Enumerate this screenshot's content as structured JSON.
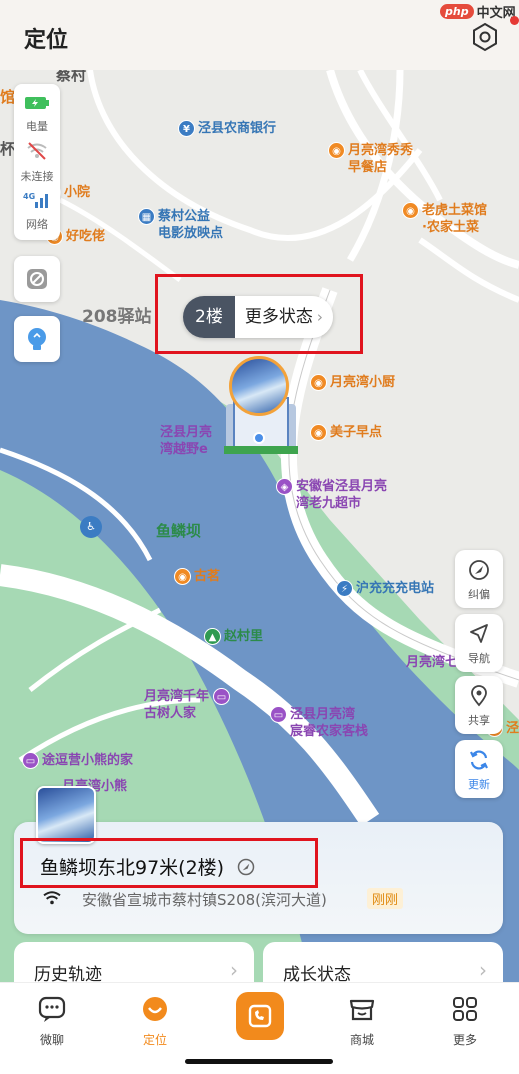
{
  "header": {
    "title": "定位",
    "watermark_brand": "php",
    "watermark_text": "中文网"
  },
  "status_panel": {
    "battery_label": "电量",
    "wifi_label": "未连接",
    "network_label": "网络",
    "network_badge": "4G"
  },
  "map": {
    "pois": [
      {
        "text": "泾县农商银行",
        "color": "blue"
      },
      {
        "text": "月亮湾秀秀\n早餐店",
        "color": "orange"
      },
      {
        "text": "老虎土菜馆\n·农家土菜",
        "color": "orange"
      },
      {
        "text": "蔡村公益\n电影放映点",
        "color": "blue"
      },
      {
        "text": "好吃佬",
        "color": "orange"
      },
      {
        "text": "小院",
        "color": "orange"
      },
      {
        "text": "月亮湾小厨",
        "color": "orange"
      },
      {
        "text": "美子早点",
        "color": "orange"
      },
      {
        "text": "泾县月亮\n湾越野e",
        "color": "purple"
      },
      {
        "text": "安徽省泾县月亮\n湾老九超市",
        "color": "purple"
      },
      {
        "text": "古茗",
        "color": "orange"
      },
      {
        "text": "沪充充充电站",
        "color": "blue"
      },
      {
        "text": "赵村里",
        "color": "green"
      },
      {
        "text": "月亮湾千年\n古树人家",
        "color": "purple"
      },
      {
        "text": "泾县月亮湾\n宸睿农家客栈",
        "color": "purple"
      },
      {
        "text": "途逗营小熊的家",
        "color": "purple"
      },
      {
        "text": "月亮湾小熊\n民宿",
        "color": "purple"
      },
      {
        "text": "月亮湾七采民宿",
        "color": "purple"
      },
      {
        "text": "泾河",
        "color": "orange"
      }
    ],
    "labels": {
      "village": "蔡村",
      "station": "208驿站",
      "dam": "鱼鳞坝",
      "edge_left1": "馆",
      "edge_left2": "杯"
    }
  },
  "floor_bubble": {
    "floor": "2楼",
    "more": "更多状态"
  },
  "tools": [
    {
      "label": "纠偏",
      "icon": "calibrate-icon"
    },
    {
      "label": "导航",
      "icon": "navigate-icon"
    },
    {
      "label": "共享",
      "icon": "share-location-icon"
    },
    {
      "label": "更新",
      "icon": "refresh-icon"
    }
  ],
  "location_card": {
    "place": "鱼鳞坝东北97米(2楼)",
    "address": "安徽省宣城市蔡村镇S208(滨河大道)",
    "time_badge": "刚刚"
  },
  "entries": {
    "history": "历史轨迹",
    "growth": "成长状态"
  },
  "tabs": [
    {
      "label": "微聊"
    },
    {
      "label": "定位"
    },
    {
      "label": "商城"
    },
    {
      "label": "更多"
    }
  ],
  "colors": {
    "accent": "#f28a1c",
    "highlight_box": "#e0141e",
    "river": "#6e95c6",
    "park": "#a6d9b4"
  }
}
